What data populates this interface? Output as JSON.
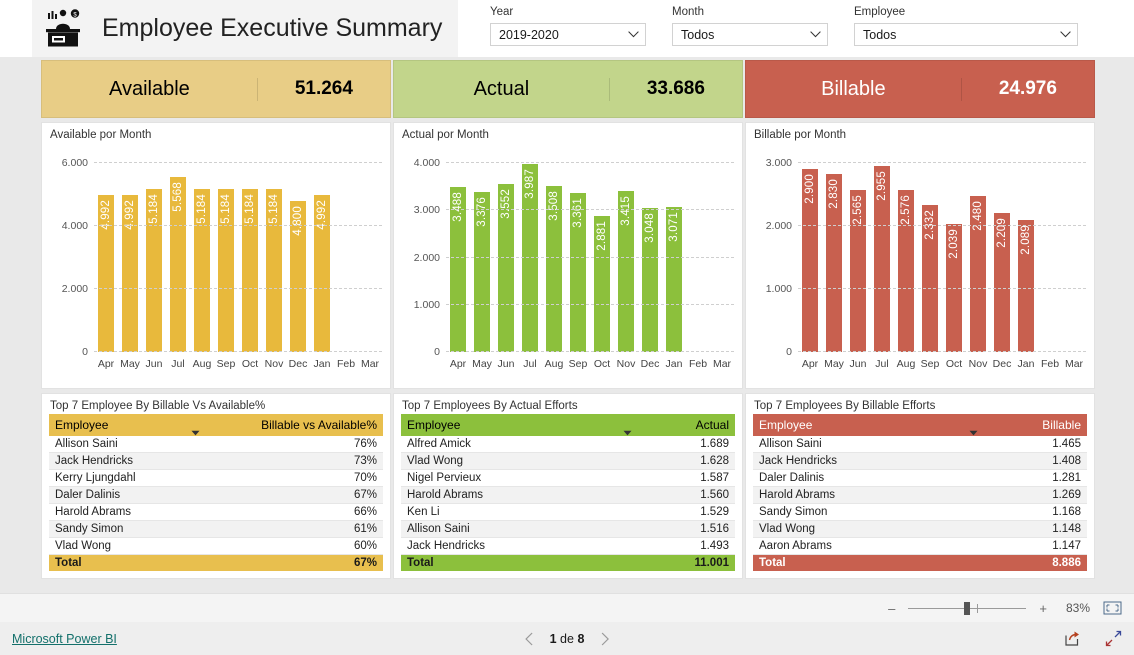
{
  "header": {
    "title": "Employee Executive Summary",
    "icon": "employee-dashboard-icon",
    "slicers": [
      {
        "label": "Year",
        "value": "2019-2020",
        "icon": "chevron-down-icon"
      },
      {
        "label": "Month",
        "value": "Todos",
        "icon": "chevron-down-icon"
      },
      {
        "label": "Employee",
        "value": "Todos",
        "icon": "chevron-down-icon"
      }
    ]
  },
  "colors": {
    "available_card": "#e8cd86",
    "available_bar": "#e8b93c",
    "actual_card": "#c2d58b",
    "actual_bar": "#8cc03c",
    "billable_card": "#c8604f",
    "billable_bar": "#c8604f",
    "brand_link": "#13706b"
  },
  "columns": [
    {
      "kpi": {
        "name": "Available",
        "value": "51.264",
        "name_color": "#1a1a1a",
        "value_color": "#1a1a1a"
      },
      "chart_title": "Available por Month",
      "table_title": "Top 7 Employee By Billable Vs Available%",
      "table_headers": {
        "name": "Employee",
        "value": "Billable vs Available%"
      },
      "rows": [
        {
          "name": "Allison Saini",
          "value": "76%"
        },
        {
          "name": "Jack Hendricks",
          "value": "73%"
        },
        {
          "name": "Kerry Ljungdahl",
          "value": "70%"
        },
        {
          "name": "Daler Dalinis",
          "value": "67%"
        },
        {
          "name": "Harold Abrams",
          "value": "66%"
        },
        {
          "name": "Sandy Simon",
          "value": "61%"
        },
        {
          "name": "Vlad Wong",
          "value": "60%"
        }
      ],
      "total": {
        "label": "Total",
        "value": "67%"
      }
    },
    {
      "kpi": {
        "name": "Actual",
        "value": "33.686",
        "name_color": "#1a1a1a",
        "value_color": "#1a1a1a"
      },
      "chart_title": "Actual por Month",
      "table_title": "Top 7 Employees By Actual Efforts",
      "table_headers": {
        "name": "Employee",
        "value": "Actual"
      },
      "rows": [
        {
          "name": "Alfred Amick",
          "value": "1.689"
        },
        {
          "name": "Vlad Wong",
          "value": "1.628"
        },
        {
          "name": "Nigel Pervieux",
          "value": "1.587"
        },
        {
          "name": "Harold Abrams",
          "value": "1.560"
        },
        {
          "name": "Ken Li",
          "value": "1.529"
        },
        {
          "name": "Allison Saini",
          "value": "1.516"
        },
        {
          "name": "Jack Hendricks",
          "value": "1.493"
        }
      ],
      "total": {
        "label": "Total",
        "value": "11.001"
      }
    },
    {
      "kpi": {
        "name": "Billable",
        "value": "24.976",
        "name_color": "#ffffff",
        "value_color": "#ffffff"
      },
      "chart_title": "Billable por Month",
      "table_title": "Top 7 Employees By Billable Efforts",
      "table_headers": {
        "name": "Employee",
        "value": "Billable"
      },
      "rows": [
        {
          "name": "Allison Saini",
          "value": "1.465"
        },
        {
          "name": "Jack Hendricks",
          "value": "1.408"
        },
        {
          "name": "Daler Dalinis",
          "value": "1.281"
        },
        {
          "name": "Harold Abrams",
          "value": "1.269"
        },
        {
          "name": "Sandy Simon",
          "value": "1.168"
        },
        {
          "name": "Vlad Wong",
          "value": "1.148"
        },
        {
          "name": "Aaron Abrams",
          "value": "1.147"
        }
      ],
      "total": {
        "label": "Total",
        "value": "8.886"
      }
    }
  ],
  "chart_data": [
    {
      "type": "bar",
      "title": "Available por Month",
      "xlabel": "",
      "ylabel": "",
      "ylim": [
        0,
        6000
      ],
      "yticks": [
        0,
        2000,
        4000,
        6000
      ],
      "ytick_labels": [
        "0",
        "2.000",
        "4.000",
        "6.000"
      ],
      "grid": true,
      "legend": "none",
      "bar_color": "#e8b93c",
      "categories": [
        "Apr",
        "May",
        "Jun",
        "Jul",
        "Aug",
        "Sep",
        "Oct",
        "Nov",
        "Dec",
        "Jan",
        "Feb",
        "Mar"
      ],
      "values": [
        4992,
        4992,
        5184,
        5568,
        5184,
        5184,
        5184,
        5184,
        4800,
        4992,
        null,
        null
      ],
      "data_labels": [
        "4.992",
        "4.992",
        "5.184",
        "5.568",
        "5.184",
        "5.184",
        "5.184",
        "5.184",
        "4.800",
        "4.992",
        "",
        ""
      ]
    },
    {
      "type": "bar",
      "title": "Actual por Month",
      "xlabel": "",
      "ylabel": "",
      "ylim": [
        0,
        4000
      ],
      "yticks": [
        0,
        1000,
        2000,
        3000,
        4000
      ],
      "ytick_labels": [
        "0",
        "1.000",
        "2.000",
        "3.000",
        "4.000"
      ],
      "grid": true,
      "legend": "none",
      "bar_color": "#8cc03c",
      "categories": [
        "Apr",
        "May",
        "Jun",
        "Jul",
        "Aug",
        "Sep",
        "Oct",
        "Nov",
        "Dec",
        "Jan",
        "Feb",
        "Mar"
      ],
      "values": [
        3488,
        3376,
        3552,
        3987,
        3508,
        3361,
        2881,
        3415,
        3048,
        3071,
        null,
        null
      ],
      "data_labels": [
        "3.488",
        "3.376",
        "3.552",
        "3.987",
        "3.508",
        "3.361",
        "2.881",
        "3.415",
        "3.048",
        "3.071",
        "",
        ""
      ]
    },
    {
      "type": "bar",
      "title": "Billable por Month",
      "xlabel": "",
      "ylabel": "",
      "ylim": [
        0,
        3000
      ],
      "yticks": [
        0,
        1000,
        2000,
        3000
      ],
      "ytick_labels": [
        "0",
        "1.000",
        "2.000",
        "3.000"
      ],
      "grid": true,
      "legend": "none",
      "bar_color": "#c8604f",
      "categories": [
        "Apr",
        "May",
        "Jun",
        "Jul",
        "Aug",
        "Sep",
        "Oct",
        "Nov",
        "Dec",
        "Jan",
        "Feb",
        "Mar"
      ],
      "values": [
        2900,
        2830,
        2565,
        2955,
        2576,
        2332,
        2039,
        2480,
        2209,
        2089,
        null,
        null
      ],
      "data_labels": [
        "2.900",
        "2.830",
        "2.565",
        "2.955",
        "2.576",
        "2.332",
        "2.039",
        "2.480",
        "2.209",
        "2.089",
        "",
        ""
      ]
    }
  ],
  "statusbar": {
    "zoom_minus": "–",
    "zoom_plus": "+",
    "zoom_percent": "83%",
    "fit_icon": "fit-to-page-icon"
  },
  "footer": {
    "brand": "Microsoft Power BI",
    "prev_icon": "chevron-left-icon",
    "next_icon": "chevron-right-icon",
    "page_current": "1",
    "page_of": "de",
    "page_total": "8",
    "share_icon": "share-icon",
    "fullscreen_icon": "fullscreen-icon"
  }
}
